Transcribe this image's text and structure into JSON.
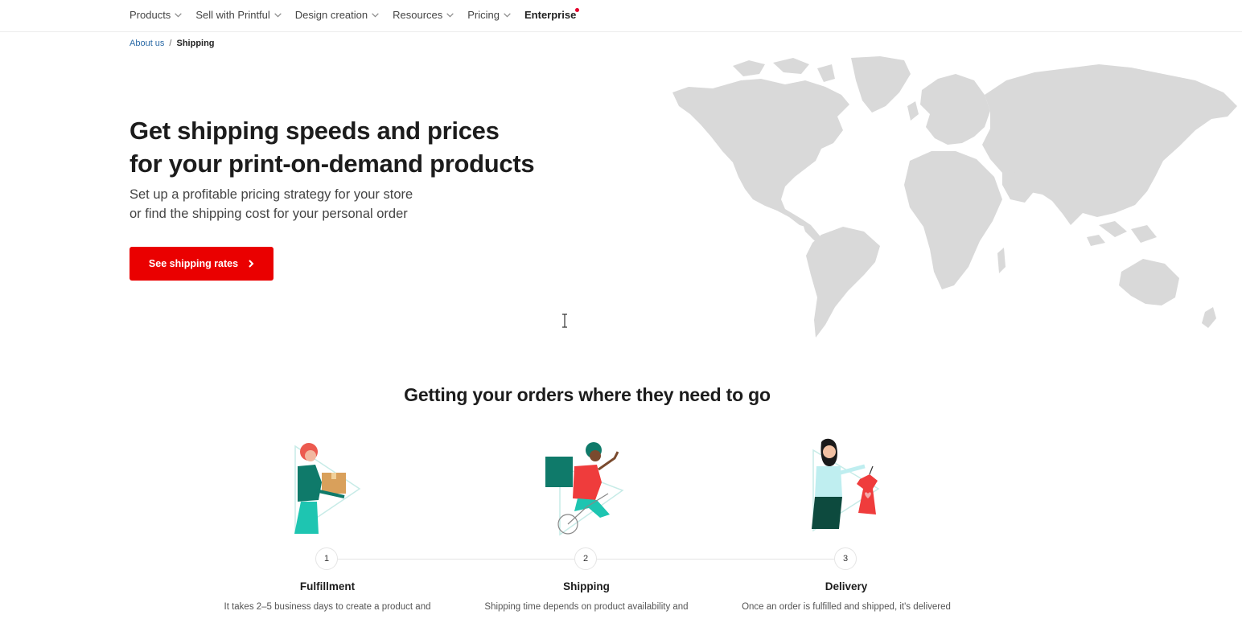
{
  "nav": {
    "items": [
      {
        "label": "Products"
      },
      {
        "label": "Sell with Printful"
      },
      {
        "label": "Design creation"
      },
      {
        "label": "Resources"
      },
      {
        "label": "Pricing"
      }
    ],
    "enterprise": "Enterprise"
  },
  "breadcrumb": {
    "parent": "About us",
    "separator": "/",
    "current": "Shipping"
  },
  "hero": {
    "title_line1": "Get shipping speeds and prices",
    "title_line2": "for your print-on-demand products",
    "subtitle_line1": "Set up a profitable pricing strategy for your store",
    "subtitle_line2": "or find the shipping cost for your personal order",
    "cta_label": "See shipping rates"
  },
  "process": {
    "title": "Getting your orders where they need to go",
    "steps": [
      {
        "number": "1",
        "title": "Fulfillment",
        "desc": "It takes 2–5 business days to create a product and"
      },
      {
        "number": "2",
        "title": "Shipping",
        "desc": "Shipping time depends on product availability and"
      },
      {
        "number": "3",
        "title": "Delivery",
        "desc": "Once an order is fulfilled and shipped, it's delivered"
      }
    ]
  },
  "colors": {
    "brand_red": "#ea0000",
    "map_gray": "#d9d9d9",
    "teal": "#0f7a6a",
    "link_blue": "#2b6aa6"
  },
  "icons": {
    "nav_chevron": "chevron-down-icon",
    "cta_arrow": "chevron-right-icon",
    "cursor": "text-cursor-icon"
  }
}
